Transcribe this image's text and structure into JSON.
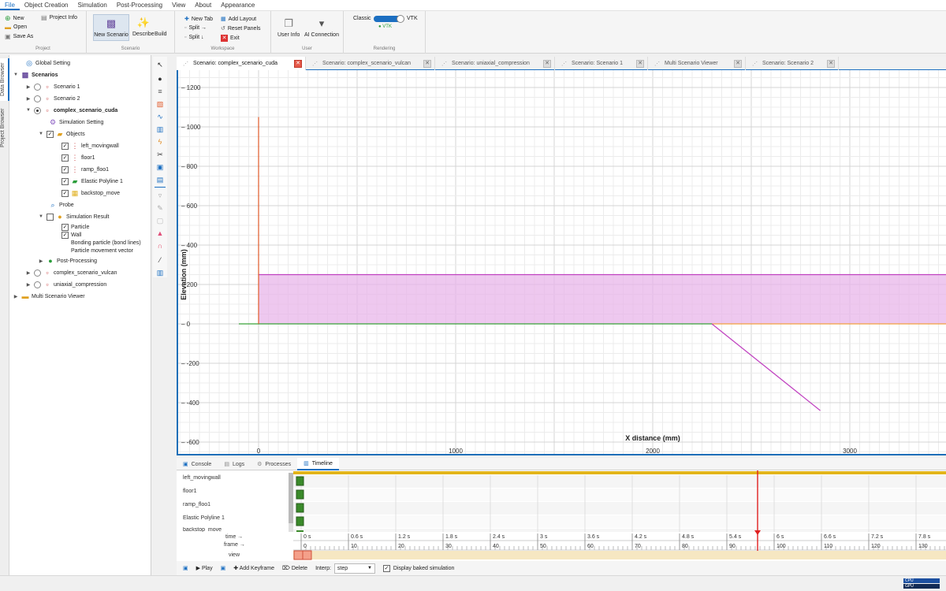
{
  "menu": [
    "File",
    "Object Creation",
    "Simulation",
    "Post-Processing",
    "View",
    "About",
    "Appearance"
  ],
  "ribbon": {
    "project": {
      "new": "New",
      "open": "Open",
      "save_as": "Save As",
      "project_info": "Project Info",
      "label": "Project"
    },
    "scenario": {
      "new_scenario": "New Scenario",
      "describe": "Describe",
      "build": "Build",
      "label": "Scenario"
    },
    "workspace": {
      "new_tab": "New Tab",
      "split_h": "Split →",
      "split_v": "Split ↓",
      "add_layout": "Add Layout",
      "reset_panels": "Reset Panels",
      "exit": "Exit",
      "label": "Workspace"
    },
    "user": {
      "user_info": "User Info",
      "ai_connection": "AI Connection",
      "label": "User"
    },
    "rendering": {
      "classic": "Classic",
      "vtk": "VTK",
      "vtk_status": "● VTK",
      "label": "Rendering"
    }
  },
  "side_tabs": [
    "Data Browser",
    "Project Browser"
  ],
  "tree": {
    "global_setting": "Global Setting",
    "scenarios": "Scenarios",
    "scenario1": "Scenario 1",
    "scenario2": "Scenario 2",
    "cuda": "complex_scenario_cuda",
    "sim_setting": "Simulation Setting",
    "objects": "Objects",
    "obj": [
      "left_movingwall",
      "floor1",
      "ramp_floo1",
      "Elastic Polyline 1",
      "backstop_move"
    ],
    "probe": "Probe",
    "sim_result": "Simulation Result",
    "results": [
      "Particle",
      "Wall",
      "Bonding particle (bond lines)",
      "Particle movement vector"
    ],
    "post_processing": "Post-Processing",
    "vulcan": "complex_scenario_vulcan",
    "uniaxial": "uniaxial_compression",
    "multi": "Multi Scenario Viewer"
  },
  "doc_tabs": [
    "Scenario: complex_scenario_cuda",
    "Scenario: complex_scenario_vulcan",
    "Scenario: uniaxial_compression",
    "Scenario: Scenario 1",
    "Multi Scenario Viewer",
    "Scenario: Scenario 2"
  ],
  "plot": {
    "xlabel": "X distance (mm)",
    "ylabel": "Elevation (mm)",
    "yticks": [
      1200,
      1000,
      800,
      600,
      400,
      200,
      0,
      -200,
      -400,
      -600
    ],
    "xticks": [
      0,
      1000,
      2000,
      3000
    ],
    "colors": {
      "wall": "#e05a2a",
      "floor": "#3aa23a",
      "ramp": "#c040c0",
      "particles": "#e8b6ea",
      "orange_floor": "#f2a040"
    }
  },
  "bottom_tabs": [
    "Console",
    "Logs",
    "Processes",
    "Timeline"
  ],
  "timeline": {
    "tracks": [
      "left_movingwall",
      "floor1",
      "ramp_floo1",
      "Elastic Polyline 1",
      "backstop_move"
    ],
    "time_label": "time →",
    "frame_label": "frame →",
    "view_label": "view",
    "times": [
      "0 s",
      "0.6 s",
      "1.2 s",
      "1.8 s",
      "2.4 s",
      "3 s",
      "3.6 s",
      "4.2 s",
      "4.8 s",
      "5.4 s",
      "6 s",
      "6.6 s",
      "7.2 s",
      "7.8 s"
    ],
    "frames": [
      "0",
      "10",
      "20",
      "30",
      "40",
      "50",
      "60",
      "70",
      "80",
      "90",
      "100",
      "110",
      "120",
      "130"
    ]
  },
  "tl_toolbar": {
    "play": "▶ Play",
    "add_keyframe": "✚ Add Keyframe",
    "delete": "Delete",
    "interp_label": "Interp:",
    "interp_value": "step",
    "baked": "Display baked simulation"
  },
  "status": {
    "cpu": "CPU",
    "gpu": "GPU"
  }
}
